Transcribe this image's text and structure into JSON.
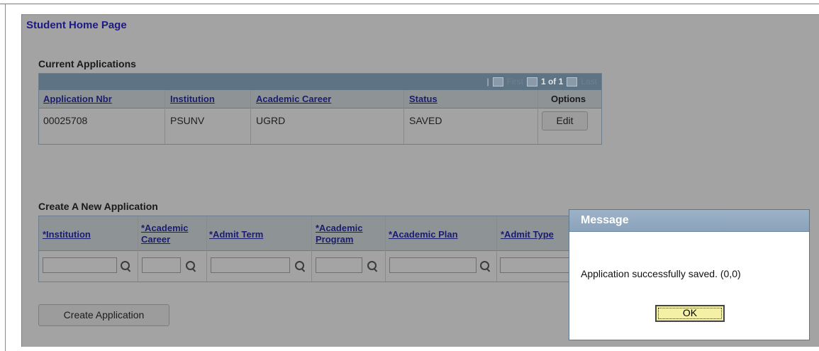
{
  "page": {
    "title": "Student Home Page"
  },
  "current_applications": {
    "label": "Current Applications",
    "nav": {
      "first": "First",
      "counter": "1 of 1",
      "last": "Last"
    },
    "columns": [
      "Application Nbr",
      "Institution",
      "Academic Career",
      "Status",
      "Options"
    ],
    "rows": [
      {
        "application_nbr": "00025708",
        "institution": "PSUNV",
        "academic_career": "UGRD",
        "status": "SAVED",
        "option_label": "Edit"
      }
    ]
  },
  "new_application": {
    "label": "Create A New Application",
    "columns": {
      "institution": "*Institution",
      "career_1": "*Academic",
      "career_2": "Career",
      "admit_term": "*Admit Term",
      "program_1": "*Academic",
      "program_2": "Program",
      "plan": "*Academic Plan",
      "admit_type": "*Admit Type"
    },
    "inputs": {
      "institution": "",
      "academic_career": "",
      "admit_term": "",
      "academic_program": "",
      "academic_plan": "",
      "admit_type": ""
    },
    "create_button": "Create Application"
  },
  "dialog": {
    "title": "Message",
    "message": "Application successfully saved. (0,0)",
    "ok_label": "OK"
  },
  "colors": {
    "overlay": "#a3a3a3",
    "grid_header": "#5e7383",
    "link": "#1b1c70",
    "dialog_header": "#8aa3bb",
    "ok_button": "#f4f1a6"
  }
}
